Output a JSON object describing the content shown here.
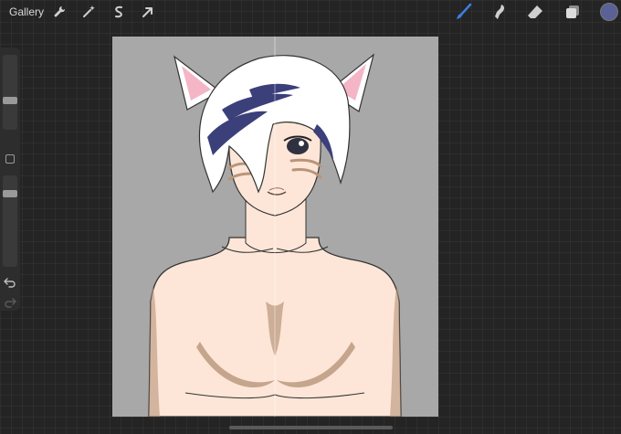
{
  "topbar": {
    "gallery_label": "Gallery",
    "left_tools": [
      "wrench-icon",
      "magic-wand-icon",
      "selection-icon",
      "transform-arrow-icon"
    ],
    "right_tools": [
      "brush-icon",
      "smudge-icon",
      "eraser-icon",
      "layers-icon",
      "color-swatch"
    ],
    "active_tool": "brush-icon",
    "active_color": "#5a6194"
  },
  "sidebar": {
    "brush_size_level": 0.35,
    "opacity_level": 0.15,
    "items": [
      "brush-size-slider",
      "modify-button",
      "opacity-slider",
      "undo-icon",
      "redo-icon"
    ]
  },
  "canvas": {
    "background_color": "#a8a8a8",
    "skin_color": "#fde6d8",
    "shadow_color": "#b8957a",
    "hair_color": "#ffffff",
    "hair_streak_color": "#3b3f7a",
    "ear_inner_color": "#f4b6c6",
    "artwork": "anime-character-with-cat-ears"
  }
}
